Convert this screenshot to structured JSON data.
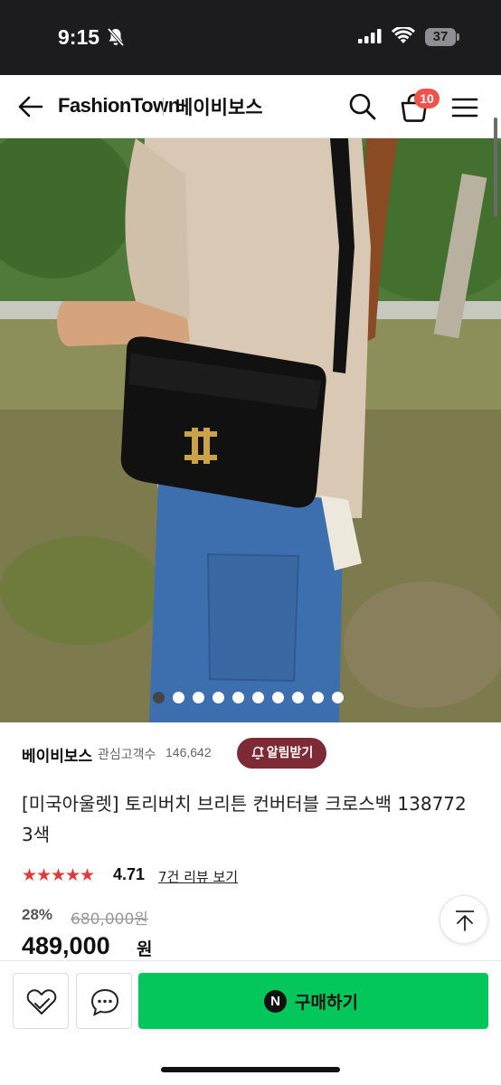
{
  "status_bar": {
    "time": "9:15",
    "battery": "37",
    "icons": [
      "bell-slash-icon",
      "signal-icon",
      "wifi-icon",
      "battery-icon"
    ]
  },
  "header": {
    "brand": "FashionTown",
    "shop_name": "베이비보스",
    "cart_count": "10",
    "icons": [
      "back-arrow-icon",
      "search-icon",
      "cart-icon",
      "menu-icon"
    ]
  },
  "gallery": {
    "total_images": 10,
    "active_index": 0
  },
  "seller": {
    "name": "베이비보스",
    "followers_label": "관심고객수",
    "followers_count": "146,642",
    "alarm_button": "알림받기"
  },
  "product": {
    "title": "[미국아울렛] 토리버치 브리튼 컨버터블 크로스백 138772 3색",
    "rating": "4.71",
    "stars": 5,
    "reviews_link": "7건 리뷰 보기",
    "discount": "28%",
    "original_price": "680,000원",
    "price": "489,000",
    "currency": "원"
  },
  "bottom_bar": {
    "buy_label": "구매하기",
    "naver_logo": "N"
  },
  "colors": {
    "alarm": "#7d2a36",
    "buy": "#03c75a",
    "star": "#e23a3a",
    "badge": "#f0534a"
  }
}
